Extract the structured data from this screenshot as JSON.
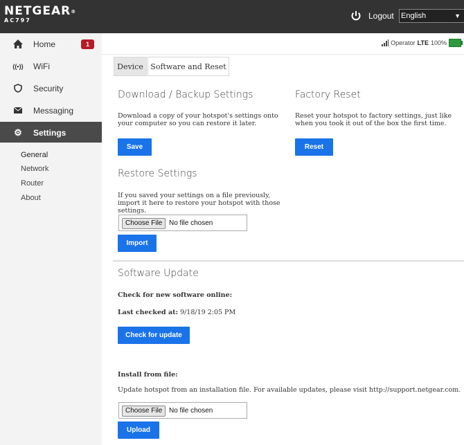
{
  "header": {
    "brand": "NETGEAR",
    "model": "AC797",
    "logout_label": "Logout",
    "language": "English"
  },
  "sidebar": {
    "items": [
      {
        "label": "Home",
        "icon": "home-icon",
        "badge": "1"
      },
      {
        "label": "WiFi",
        "icon": "wifi-icon"
      },
      {
        "label": "Security",
        "icon": "shield-icon"
      },
      {
        "label": "Messaging",
        "icon": "envelope-icon"
      },
      {
        "label": "Settings",
        "icon": "gear-icon",
        "active": true
      }
    ],
    "subitems": [
      "General",
      "Network",
      "Router",
      "About"
    ],
    "selected_subitem": "General"
  },
  "status": {
    "operator": "Operator",
    "network": "LTE",
    "battery": "100%",
    "battery_color": "#2e9a3e"
  },
  "tabs": [
    {
      "label": "Device",
      "active": true
    },
    {
      "label": "Software and Reset",
      "active": false
    }
  ],
  "backup": {
    "title": "Download / Backup Settings",
    "description": "Download a copy of your hotspot's settings onto your computer so you can restore it later.",
    "button": "Save"
  },
  "factory": {
    "title": "Factory Reset",
    "description": "Reset your hotspot to factory settings, just like when you took it out of the box the first time.",
    "button": "Reset"
  },
  "restore": {
    "title": "Restore Settings",
    "description": "If you saved your settings on a file previously, import it here to restore your hotspot with those settings.",
    "choose_file": "Choose File",
    "no_file": "No file chosen",
    "button": "Import"
  },
  "software": {
    "title": "Software Update",
    "check_online": "Check for new software online:",
    "last_checked_label": "Last checked at:",
    "last_checked_value": "9/18/19 2:05 PM",
    "check_button": "Check for update",
    "install_title": "Install from file:",
    "install_description": "Update hotspot from an installation file.  For available updates, please visit",
    "install_link": "http://support.netgear.com.",
    "choose_file": "Choose File",
    "no_file": "No file chosen",
    "upload_button": "Upload"
  },
  "colors": {
    "accent": "#1a73e8",
    "topbar": "#333333",
    "badge": "#b51c2a",
    "active_nav": "#4a4a4a"
  }
}
